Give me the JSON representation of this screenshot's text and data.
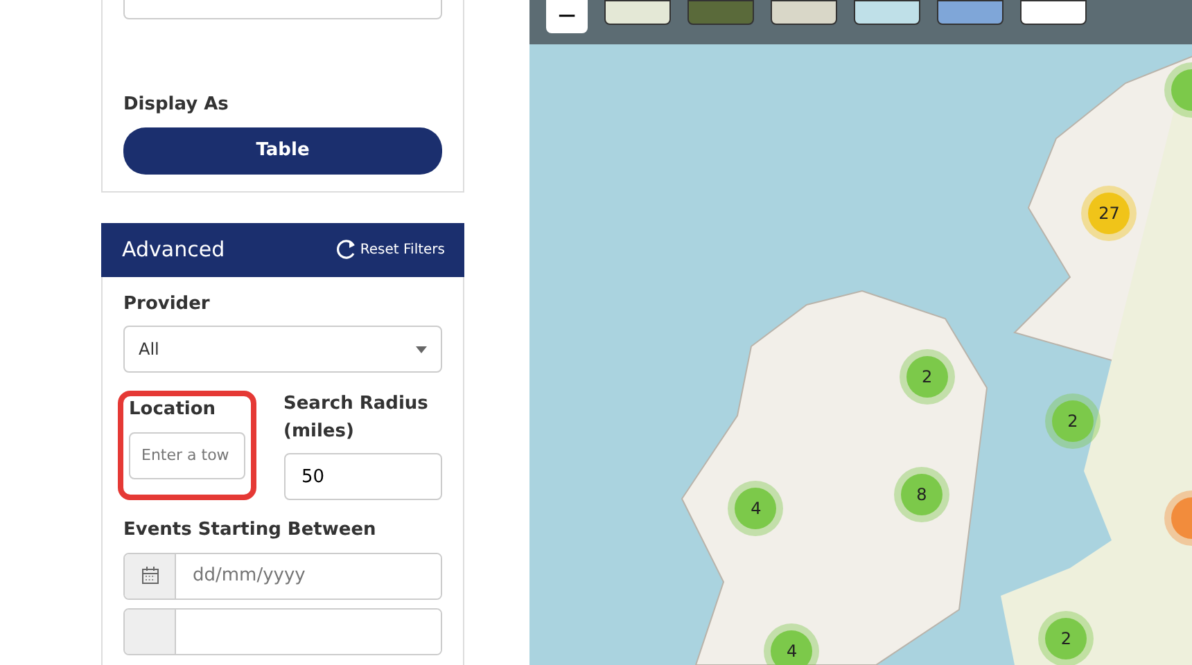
{
  "display_as": {
    "label": "Display As",
    "button": "Table"
  },
  "advanced": {
    "title": "Advanced",
    "reset": "Reset Filters",
    "provider": {
      "label": "Provider",
      "value": "All"
    },
    "location": {
      "label": "Location",
      "placeholder": "Enter a tow",
      "highlighted": true
    },
    "radius": {
      "label": "Search Radius (miles)",
      "value": "50"
    },
    "events": {
      "label": "Events Starting Between",
      "placeholder": "dd/mm/yyyy"
    }
  },
  "map": {
    "zoom_out": "−",
    "clusters": [
      {
        "count": "27",
        "color": "#f0c419"
      },
      {
        "color": "#7cc94a"
      },
      {
        "count": "2",
        "color": "#7cc94a"
      },
      {
        "count": "2",
        "color": "#7cc94a"
      },
      {
        "count": "8",
        "color": "#7cc94a"
      },
      {
        "count": "4",
        "color": "#7cc94a"
      },
      {
        "count": "4",
        "color": "#7cc94a"
      },
      {
        "count": "2",
        "color": "#7cc94a"
      },
      {
        "color": "#f28c3c"
      }
    ]
  }
}
